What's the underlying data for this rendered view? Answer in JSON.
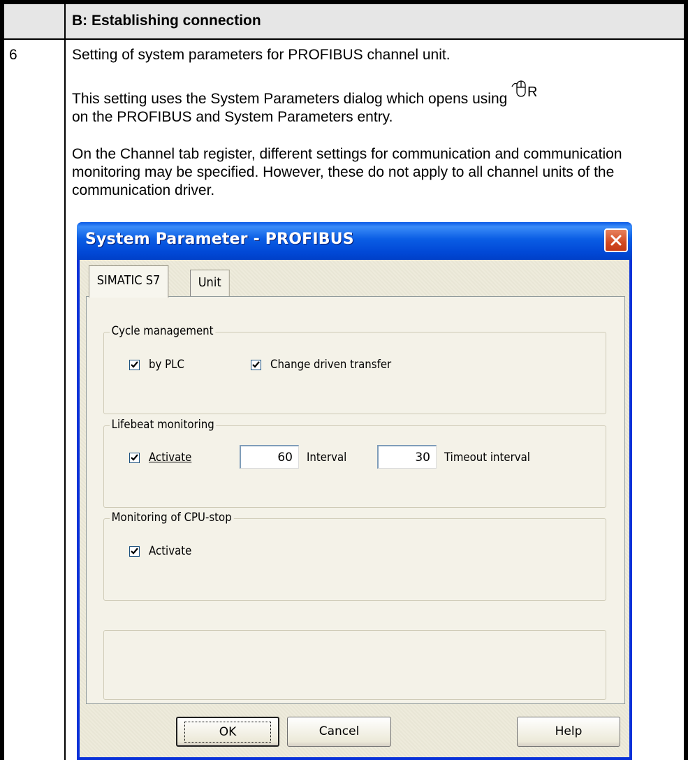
{
  "header": {
    "title": "B: Establishing connection"
  },
  "row": {
    "number": "6",
    "paragraph1": "Setting of system parameters for PROFIBUS channel unit.",
    "paragraph2_before_icon": "This setting uses the System Parameters dialog which opens using",
    "icon_letter": "R",
    "paragraph2_after_icon": "on the PROFIBUS and System Parameters entry.",
    "paragraph3": "On the Channel tab register, different settings for communication and communication monitoring may be specified. However, these do not apply to all channel units of the communication driver."
  },
  "dialog": {
    "title": "System Parameter - PROFIBUS",
    "tabs": [
      {
        "label": "SIMATIC S7",
        "active": true
      },
      {
        "label": "Unit",
        "active": false
      }
    ],
    "cycle_management": {
      "legend": "Cycle management",
      "by_plc": {
        "label": "by PLC",
        "checked": true
      },
      "change_driven": {
        "label": "Change driven transfer",
        "checked": true
      }
    },
    "lifebeat_monitoring": {
      "legend": "Lifebeat monitoring",
      "activate": {
        "label": "Activate",
        "checked": true
      },
      "interval_value": "60",
      "interval_label": "Interval",
      "timeout_value": "30",
      "timeout_label": "Timeout interval"
    },
    "cpu_stop_monitoring": {
      "legend": "Monitoring of CPU-stop",
      "activate": {
        "label": "Activate",
        "checked": true
      }
    },
    "buttons": {
      "ok": "OK",
      "cancel": "Cancel",
      "help": "Help"
    }
  },
  "icons": {
    "mouse": "mouse-right-click-icon",
    "close": "close-icon",
    "checkbox": "checkmark-icon"
  },
  "colors": {
    "titlebar": "#0a5de4",
    "dialog_face": "#ece9d8",
    "close_button": "#d24a22",
    "header_row": "#e6e6e6"
  }
}
